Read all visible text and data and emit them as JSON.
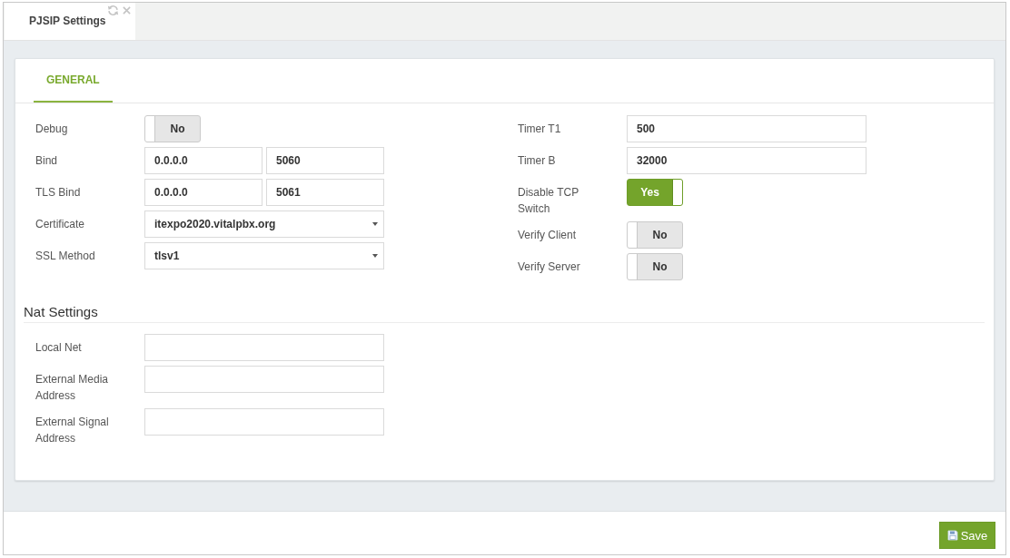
{
  "tabs": [
    {
      "label": "PJSIP Settings",
      "selected": true
    }
  ],
  "panel": {
    "section_tabs": [
      {
        "label": "GENERAL",
        "selected": true
      }
    ],
    "general": {
      "left_fields": [
        {
          "kind": "toggle",
          "label": "Debug",
          "on": false,
          "text": "No"
        },
        {
          "kind": "pair",
          "label": "Bind",
          "values": [
            "0.0.0.0",
            "5060"
          ]
        },
        {
          "kind": "pair",
          "label": "TLS Bind",
          "values": [
            "0.0.0.0",
            "5061"
          ]
        },
        {
          "kind": "select",
          "label": "Certificate",
          "value": "itexpo2020.vitalpbx.org"
        },
        {
          "kind": "select",
          "label": "SSL Method",
          "value": "tlsv1"
        }
      ],
      "right_fields": [
        {
          "kind": "text",
          "label": "Timer T1",
          "value": "500"
        },
        {
          "kind": "text",
          "label": "Timer B",
          "value": "32000"
        },
        {
          "kind": "toggle",
          "label": "Disable TCP Switch",
          "on": true,
          "text": "Yes"
        },
        {
          "kind": "toggle",
          "label": "Verify Client",
          "on": false,
          "text": "No"
        },
        {
          "kind": "toggle",
          "label": "Verify Server",
          "on": false,
          "text": "No"
        }
      ]
    },
    "nat_settings": {
      "title": "Nat Settings",
      "fields": [
        {
          "kind": "text",
          "label": "Local Net"
        },
        {
          "kind": "text",
          "label": "External Media Address"
        },
        {
          "kind": "text",
          "label": "External Signal Address"
        }
      ]
    }
  },
  "footer": {
    "save_button": "Save"
  }
}
